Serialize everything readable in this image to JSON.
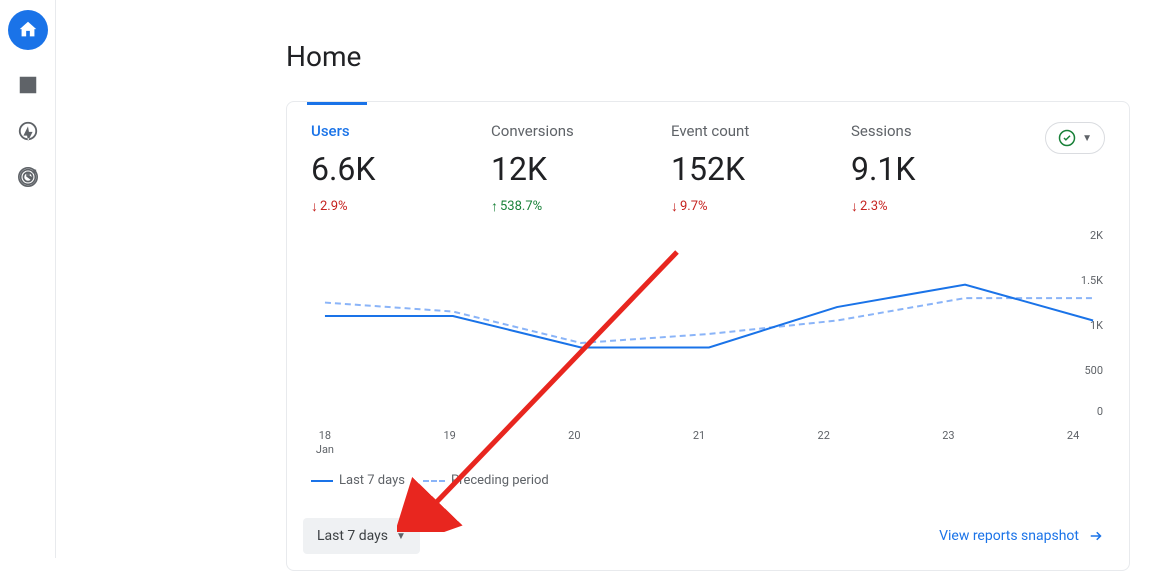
{
  "title": "Home",
  "metrics": [
    {
      "label": "Users",
      "value": "6.6K",
      "change": "2.9%",
      "direction": "down",
      "active": true
    },
    {
      "label": "Conversions",
      "value": "12K",
      "change": "538.7%",
      "direction": "up",
      "active": false
    },
    {
      "label": "Event count",
      "value": "152K",
      "change": "9.7%",
      "direction": "down",
      "active": false
    },
    {
      "label": "Sessions",
      "value": "9.1K",
      "change": "2.3%",
      "direction": "down",
      "active": false
    }
  ],
  "legend": {
    "current": "Last 7 days",
    "prev": "Preceding period"
  },
  "date_chip": "Last 7 days",
  "view_link": "View reports snapshot",
  "chart_data": {
    "type": "line",
    "title": "Home",
    "xlabel": "Jan",
    "ylabel": "",
    "ylim": [
      0,
      2000
    ],
    "categories": [
      "18",
      "19",
      "20",
      "21",
      "22",
      "23",
      "24"
    ],
    "x_sublabel": "Jan",
    "y_ticks": [
      "2K",
      "1.5K",
      "1K",
      "500",
      "0"
    ],
    "series": [
      {
        "name": "Last 7 days",
        "values": [
          1100,
          1100,
          750,
          750,
          1200,
          1450,
          1050
        ]
      },
      {
        "name": "Preceding period",
        "values": [
          1250,
          1150,
          800,
          900,
          1050,
          1300,
          1300
        ]
      }
    ],
    "annotations": [],
    "legend_position": "bottom"
  },
  "colors": {
    "primary": "#1a73e8",
    "down": "#c5221f",
    "up": "#188038",
    "secondary_line": "#8ab4f8"
  }
}
